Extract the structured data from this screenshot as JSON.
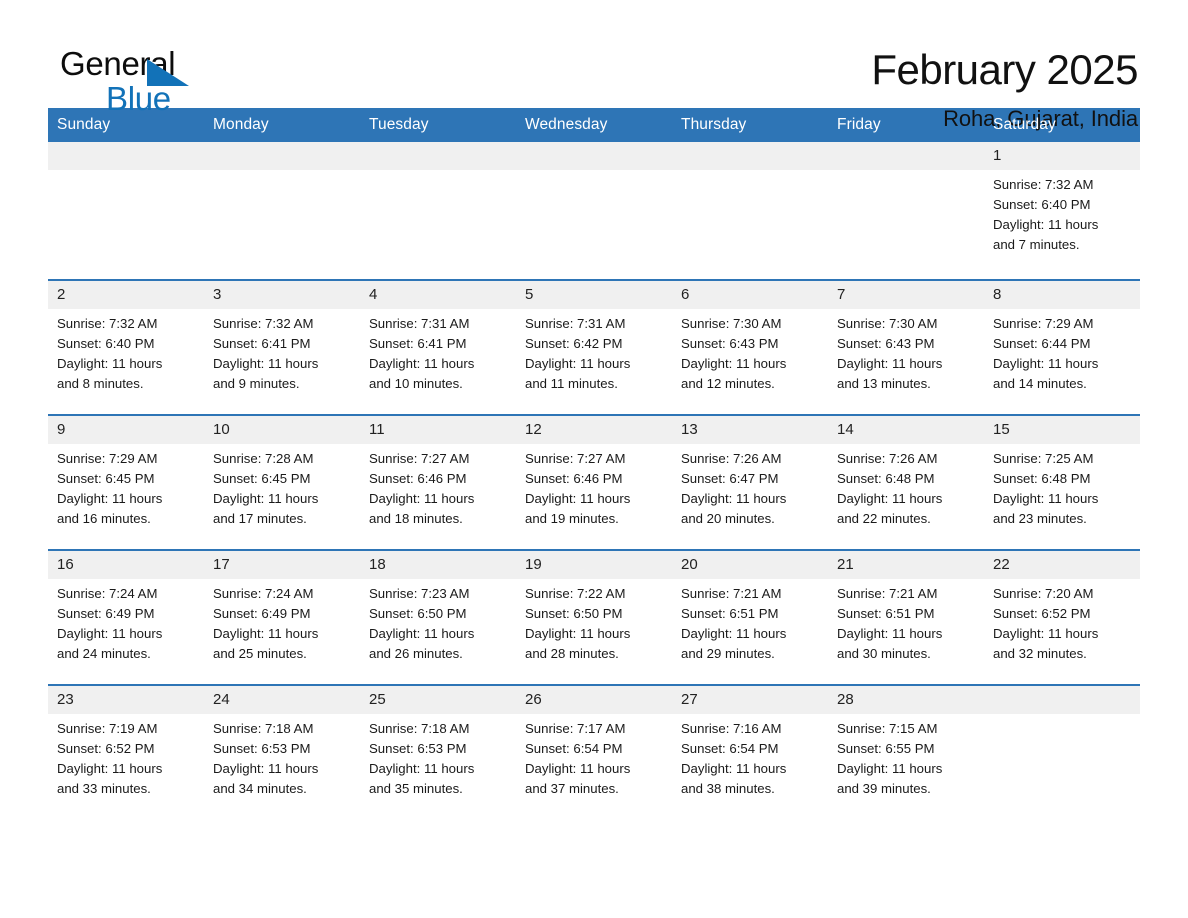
{
  "brand": {
    "name_part1": "General",
    "name_part2": "Blue",
    "triangle_color": "#1272b8"
  },
  "header": {
    "title": "February 2025",
    "subtitle": "Roha, Gujarat, India"
  },
  "theme": {
    "header_blue": "#2e75b6",
    "daynum_band": "#f0f0f0",
    "text": "#1a1a1a"
  },
  "labels": {
    "sunrise_prefix": "Sunrise:",
    "sunset_prefix": "Sunset:",
    "daylight_prefix": "Daylight:"
  },
  "weekday_headers": [
    "Sunday",
    "Monday",
    "Tuesday",
    "Wednesday",
    "Thursday",
    "Friday",
    "Saturday"
  ],
  "weeks": [
    [
      {
        "day": "",
        "sunrise": "",
        "sunset": "",
        "daylight_line1": "",
        "daylight_line2": ""
      },
      {
        "day": "",
        "sunrise": "",
        "sunset": "",
        "daylight_line1": "",
        "daylight_line2": ""
      },
      {
        "day": "",
        "sunrise": "",
        "sunset": "",
        "daylight_line1": "",
        "daylight_line2": ""
      },
      {
        "day": "",
        "sunrise": "",
        "sunset": "",
        "daylight_line1": "",
        "daylight_line2": ""
      },
      {
        "day": "",
        "sunrise": "",
        "sunset": "",
        "daylight_line1": "",
        "daylight_line2": ""
      },
      {
        "day": "",
        "sunrise": "",
        "sunset": "",
        "daylight_line1": "",
        "daylight_line2": ""
      },
      {
        "day": "1",
        "sunrise": "Sunrise: 7:32 AM",
        "sunset": "Sunset: 6:40 PM",
        "daylight_line1": "Daylight: 11 hours",
        "daylight_line2": "and 7 minutes."
      }
    ],
    [
      {
        "day": "2",
        "sunrise": "Sunrise: 7:32 AM",
        "sunset": "Sunset: 6:40 PM",
        "daylight_line1": "Daylight: 11 hours",
        "daylight_line2": "and 8 minutes."
      },
      {
        "day": "3",
        "sunrise": "Sunrise: 7:32 AM",
        "sunset": "Sunset: 6:41 PM",
        "daylight_line1": "Daylight: 11 hours",
        "daylight_line2": "and 9 minutes."
      },
      {
        "day": "4",
        "sunrise": "Sunrise: 7:31 AM",
        "sunset": "Sunset: 6:41 PM",
        "daylight_line1": "Daylight: 11 hours",
        "daylight_line2": "and 10 minutes."
      },
      {
        "day": "5",
        "sunrise": "Sunrise: 7:31 AM",
        "sunset": "Sunset: 6:42 PM",
        "daylight_line1": "Daylight: 11 hours",
        "daylight_line2": "and 11 minutes."
      },
      {
        "day": "6",
        "sunrise": "Sunrise: 7:30 AM",
        "sunset": "Sunset: 6:43 PM",
        "daylight_line1": "Daylight: 11 hours",
        "daylight_line2": "and 12 minutes."
      },
      {
        "day": "7",
        "sunrise": "Sunrise: 7:30 AM",
        "sunset": "Sunset: 6:43 PM",
        "daylight_line1": "Daylight: 11 hours",
        "daylight_line2": "and 13 minutes."
      },
      {
        "day": "8",
        "sunrise": "Sunrise: 7:29 AM",
        "sunset": "Sunset: 6:44 PM",
        "daylight_line1": "Daylight: 11 hours",
        "daylight_line2": "and 14 minutes."
      }
    ],
    [
      {
        "day": "9",
        "sunrise": "Sunrise: 7:29 AM",
        "sunset": "Sunset: 6:45 PM",
        "daylight_line1": "Daylight: 11 hours",
        "daylight_line2": "and 16 minutes."
      },
      {
        "day": "10",
        "sunrise": "Sunrise: 7:28 AM",
        "sunset": "Sunset: 6:45 PM",
        "daylight_line1": "Daylight: 11 hours",
        "daylight_line2": "and 17 minutes."
      },
      {
        "day": "11",
        "sunrise": "Sunrise: 7:27 AM",
        "sunset": "Sunset: 6:46 PM",
        "daylight_line1": "Daylight: 11 hours",
        "daylight_line2": "and 18 minutes."
      },
      {
        "day": "12",
        "sunrise": "Sunrise: 7:27 AM",
        "sunset": "Sunset: 6:46 PM",
        "daylight_line1": "Daylight: 11 hours",
        "daylight_line2": "and 19 minutes."
      },
      {
        "day": "13",
        "sunrise": "Sunrise: 7:26 AM",
        "sunset": "Sunset: 6:47 PM",
        "daylight_line1": "Daylight: 11 hours",
        "daylight_line2": "and 20 minutes."
      },
      {
        "day": "14",
        "sunrise": "Sunrise: 7:26 AM",
        "sunset": "Sunset: 6:48 PM",
        "daylight_line1": "Daylight: 11 hours",
        "daylight_line2": "and 22 minutes."
      },
      {
        "day": "15",
        "sunrise": "Sunrise: 7:25 AM",
        "sunset": "Sunset: 6:48 PM",
        "daylight_line1": "Daylight: 11 hours",
        "daylight_line2": "and 23 minutes."
      }
    ],
    [
      {
        "day": "16",
        "sunrise": "Sunrise: 7:24 AM",
        "sunset": "Sunset: 6:49 PM",
        "daylight_line1": "Daylight: 11 hours",
        "daylight_line2": "and 24 minutes."
      },
      {
        "day": "17",
        "sunrise": "Sunrise: 7:24 AM",
        "sunset": "Sunset: 6:49 PM",
        "daylight_line1": "Daylight: 11 hours",
        "daylight_line2": "and 25 minutes."
      },
      {
        "day": "18",
        "sunrise": "Sunrise: 7:23 AM",
        "sunset": "Sunset: 6:50 PM",
        "daylight_line1": "Daylight: 11 hours",
        "daylight_line2": "and 26 minutes."
      },
      {
        "day": "19",
        "sunrise": "Sunrise: 7:22 AM",
        "sunset": "Sunset: 6:50 PM",
        "daylight_line1": "Daylight: 11 hours",
        "daylight_line2": "and 28 minutes."
      },
      {
        "day": "20",
        "sunrise": "Sunrise: 7:21 AM",
        "sunset": "Sunset: 6:51 PM",
        "daylight_line1": "Daylight: 11 hours",
        "daylight_line2": "and 29 minutes."
      },
      {
        "day": "21",
        "sunrise": "Sunrise: 7:21 AM",
        "sunset": "Sunset: 6:51 PM",
        "daylight_line1": "Daylight: 11 hours",
        "daylight_line2": "and 30 minutes."
      },
      {
        "day": "22",
        "sunrise": "Sunrise: 7:20 AM",
        "sunset": "Sunset: 6:52 PM",
        "daylight_line1": "Daylight: 11 hours",
        "daylight_line2": "and 32 minutes."
      }
    ],
    [
      {
        "day": "23",
        "sunrise": "Sunrise: 7:19 AM",
        "sunset": "Sunset: 6:52 PM",
        "daylight_line1": "Daylight: 11 hours",
        "daylight_line2": "and 33 minutes."
      },
      {
        "day": "24",
        "sunrise": "Sunrise: 7:18 AM",
        "sunset": "Sunset: 6:53 PM",
        "daylight_line1": "Daylight: 11 hours",
        "daylight_line2": "and 34 minutes."
      },
      {
        "day": "25",
        "sunrise": "Sunrise: 7:18 AM",
        "sunset": "Sunset: 6:53 PM",
        "daylight_line1": "Daylight: 11 hours",
        "daylight_line2": "and 35 minutes."
      },
      {
        "day": "26",
        "sunrise": "Sunrise: 7:17 AM",
        "sunset": "Sunset: 6:54 PM",
        "daylight_line1": "Daylight: 11 hours",
        "daylight_line2": "and 37 minutes."
      },
      {
        "day": "27",
        "sunrise": "Sunrise: 7:16 AM",
        "sunset": "Sunset: 6:54 PM",
        "daylight_line1": "Daylight: 11 hours",
        "daylight_line2": "and 38 minutes."
      },
      {
        "day": "28",
        "sunrise": "Sunrise: 7:15 AM",
        "sunset": "Sunset: 6:55 PM",
        "daylight_line1": "Daylight: 11 hours",
        "daylight_line2": "and 39 minutes."
      },
      {
        "day": "",
        "sunrise": "",
        "sunset": "",
        "daylight_line1": "",
        "daylight_line2": ""
      }
    ]
  ]
}
